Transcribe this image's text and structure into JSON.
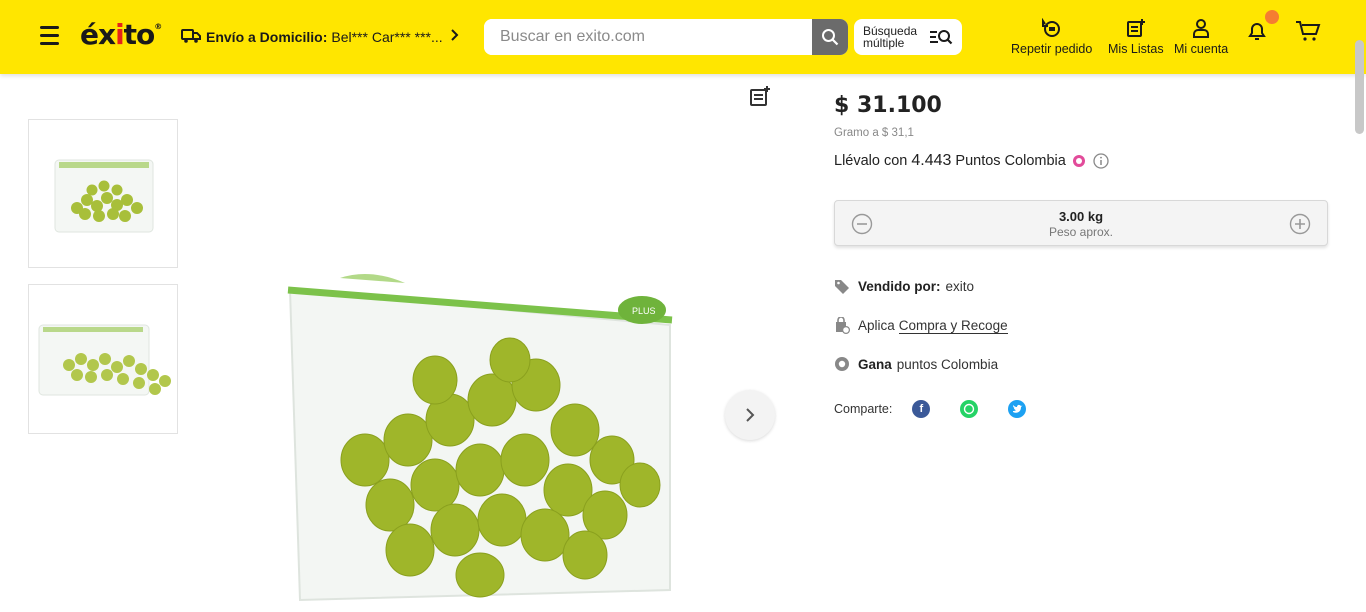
{
  "header": {
    "logo_text": "éx",
    "logo_dot": "i",
    "logo_rest": "to",
    "logo_reg": "®",
    "delivery_label": "Envío a Domicilio:",
    "delivery_address": "Bel*** Car*** ***...",
    "search_placeholder": "Buscar en exito.com",
    "multi_search_line1": "Búsqueda",
    "multi_search_line2": "múltiple",
    "repeat_order": "Repetir pedido",
    "my_lists": "Mis Listas",
    "my_account": "Mi cuenta",
    "accent_color": "#ffe600"
  },
  "product": {
    "price": "$ 31.100",
    "unit_price": "Gramo a $ 31,1",
    "points_prefix": "Llévalo con",
    "points_value": "4.443",
    "points_suffix": "Puntos Colombia",
    "quantity_value": "3.00 kg",
    "quantity_note": "Peso aprox.",
    "sold_by_label": "Vendido por:",
    "sold_by_value": "exito",
    "applies_label": "Aplica",
    "applies_link": "Compra y Recoge",
    "earn_label": "Gana",
    "earn_value": "puntos Colombia",
    "share_label": "Comparte:",
    "share_icons": [
      "facebook-icon",
      "whatsapp-icon",
      "twitter-icon"
    ],
    "bag_print_text": "PLUS"
  }
}
